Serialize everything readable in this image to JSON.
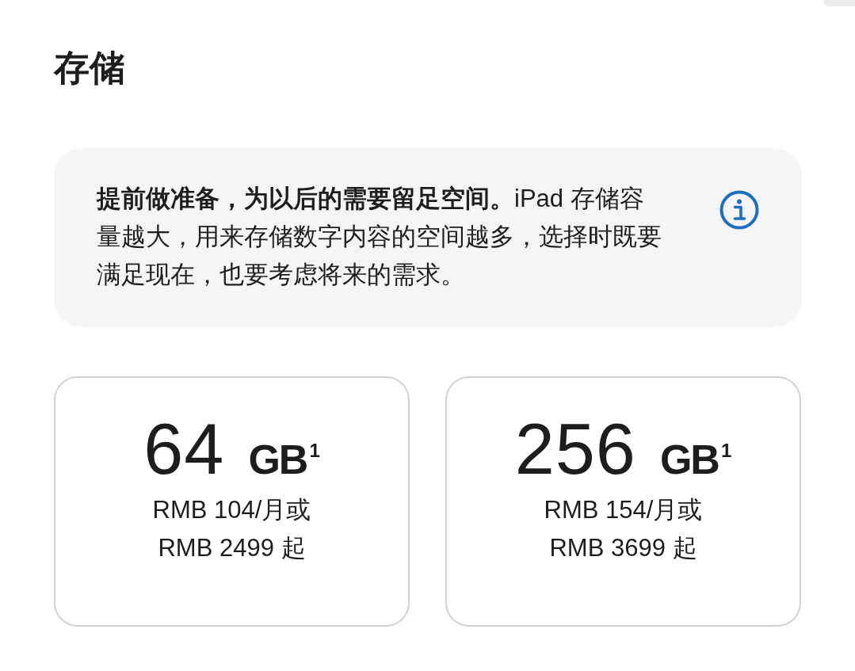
{
  "heading": "存储",
  "info": {
    "text": "**提前做准备，为以后的需要留足空间。**iPad 存储容量越大，用来存储数字内容的空间越多，选择时既要满足现在，也要考虑将来的需求。"
  },
  "options": [
    {
      "capacity": "64",
      "unit": "GB",
      "footnote": "1",
      "monthly": "RMB 104/月或",
      "price": "RMB 2499 起",
      "selected": false
    },
    {
      "capacity": "256",
      "unit": "GB",
      "footnote": "1",
      "monthly": "RMB 154/月或",
      "price": "RMB 3699 起",
      "selected": false
    }
  ]
}
